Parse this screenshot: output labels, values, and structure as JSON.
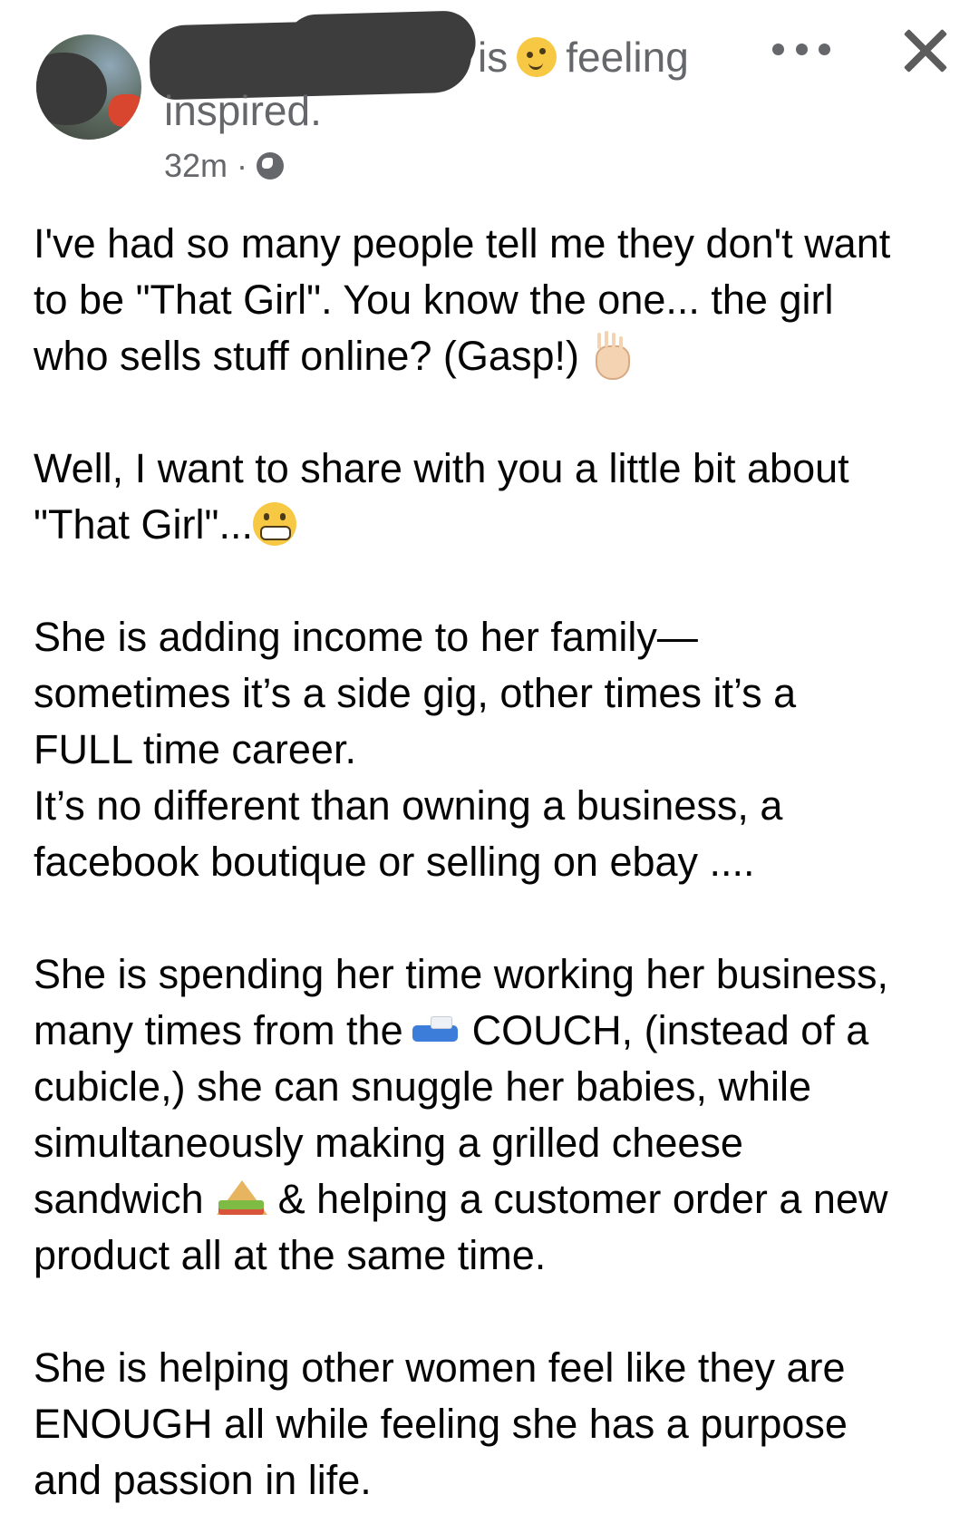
{
  "post": {
    "status_verb": "is",
    "status_emoji": "face-emoji",
    "status_word": "feeling",
    "status_rest": "inspired.",
    "time": "32m",
    "separator": "·",
    "privacy_icon": "globe-icon",
    "menu_icon": "more-icon",
    "close_icon": "close-icon"
  },
  "body": {
    "p1": {
      "l1": "I've had so many people tell me they don't want",
      "l2": "to be \"That Girl\". You know the one... the girl",
      "l3": "who sells stuff online? (Gasp!)"
    },
    "p2": {
      "l1": "Well, I want to share with you a little bit about",
      "l2": "\"That Girl\"..."
    },
    "p3": {
      "l1": "She is adding income to her family—",
      "l2": "sometimes it’s a side gig, other times it’s a",
      "l3": "FULL time career.",
      "l4": "It’s no different than owning a business, a",
      "l5": "facebook boutique or selling on ebay ...."
    },
    "p4": {
      "l1": "She is spending her time working her business,",
      "l2a": "many times from the",
      "l2b": "COUCH, (instead of a",
      "l3": "cubicle,) she can snuggle her babies, while",
      "l4": "simultaneously making a grilled cheese",
      "l5a": "sandwich",
      "l5b": "& helping a customer order a new",
      "l6": "product all at the same time."
    },
    "p5": {
      "l1": "She is helping other women feel like they are",
      "l2": "ENOUGH all while feeling she has a purpose",
      "l3": "and passion in life."
    },
    "emojis": {
      "hand": "raised-hand-emoji",
      "grimace": "grimacing-face-emoji",
      "couch": "couch-emoji",
      "sandwich": "sandwich-emoji"
    }
  },
  "colors": {
    "text": "#050505",
    "secondary": "#65676b",
    "background": "#ffffff"
  }
}
